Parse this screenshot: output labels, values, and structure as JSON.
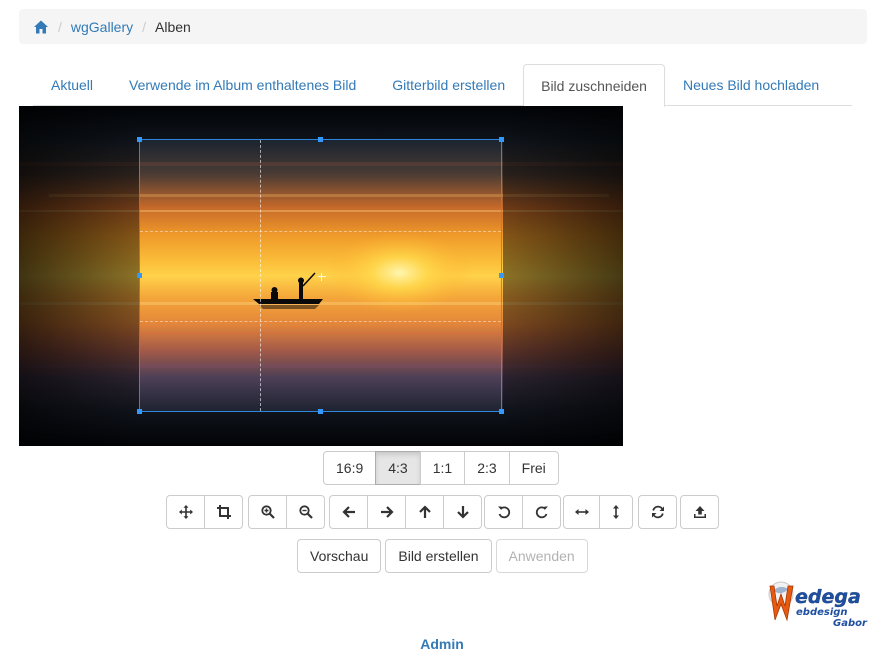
{
  "breadcrumb": {
    "home_icon": "home-icon",
    "items": [
      {
        "label": "wgGallery"
      },
      {
        "label": "Alben"
      }
    ]
  },
  "tabs": [
    {
      "label": "Aktuell",
      "active": false
    },
    {
      "label": "Verwende im Album enthaltenes Bild",
      "active": false
    },
    {
      "label": "Gitterbild erstellen",
      "active": false
    },
    {
      "label": "Bild zuschneiden",
      "active": true
    },
    {
      "label": "Neues Bild hochladen",
      "active": false
    }
  ],
  "cropper": {
    "image": "sunset-lake-boat",
    "selected_ratio": "4:3"
  },
  "ratios": [
    "16:9",
    "4:3",
    "1:1",
    "2:3",
    "Frei"
  ],
  "tools": [
    [
      "move-icon",
      "crop-icon"
    ],
    [
      "zoom-in-icon",
      "zoom-out-icon"
    ],
    [
      "arrow-left-icon",
      "arrow-right-icon",
      "arrow-up-icon",
      "arrow-down-icon"
    ],
    [
      "rotate-left-icon",
      "rotate-right-icon"
    ],
    [
      "flip-horizontal-icon",
      "flip-vertical-icon"
    ],
    [
      "reset-icon"
    ],
    [
      "upload-icon"
    ]
  ],
  "actions": {
    "preview": "Vorschau",
    "create": "Bild erstellen",
    "apply": "Anwenden"
  },
  "logo": {
    "text1": "edega",
    "text2": "ebdesign",
    "text3": "Gabor"
  },
  "footer": {
    "admin": "Admin"
  }
}
